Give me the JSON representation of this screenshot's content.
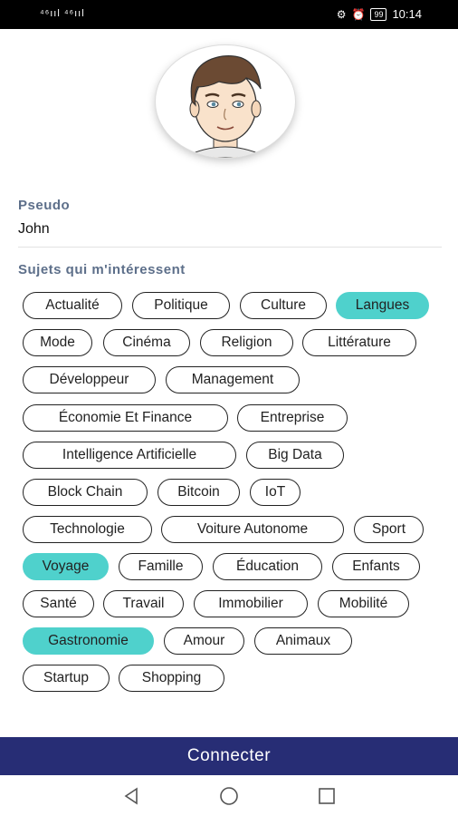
{
  "status_bar": {
    "signal": "⁴⁶ııl ⁴⁶ııl",
    "battery": "99",
    "time": "10:14"
  },
  "profile": {
    "pseudo_label": "Pseudo",
    "pseudo_value": "John",
    "subjects_label": "Sujets qui m'intéressent"
  },
  "tags": [
    {
      "label": "Actualité",
      "selected": false
    },
    {
      "label": "Politique",
      "selected": false
    },
    {
      "label": "Culture",
      "selected": false
    },
    {
      "label": "Langues",
      "selected": true
    },
    {
      "label": "Mode",
      "selected": false
    },
    {
      "label": "Cinéma",
      "selected": false
    },
    {
      "label": "Religion",
      "selected": false
    },
    {
      "label": "Littérature",
      "selected": false
    },
    {
      "label": "Développeur",
      "selected": false
    },
    {
      "label": "Management",
      "selected": false
    },
    {
      "label": "Économie Et Finance",
      "selected": false
    },
    {
      "label": "Entreprise",
      "selected": false
    },
    {
      "label": "Intelligence Artificielle",
      "selected": false
    },
    {
      "label": "Big Data",
      "selected": false
    },
    {
      "label": "Block Chain",
      "selected": false
    },
    {
      "label": "Bitcoin",
      "selected": false
    },
    {
      "label": "IoT",
      "selected": false
    },
    {
      "label": "Technologie",
      "selected": false
    },
    {
      "label": "Voiture Autonome",
      "selected": false
    },
    {
      "label": "Sport",
      "selected": false
    },
    {
      "label": "Voyage",
      "selected": true
    },
    {
      "label": "Famille",
      "selected": false
    },
    {
      "label": "Éducation",
      "selected": false
    },
    {
      "label": "Enfants",
      "selected": false
    },
    {
      "label": "Santé",
      "selected": false
    },
    {
      "label": "Travail",
      "selected": false
    },
    {
      "label": "Immobilier",
      "selected": false
    },
    {
      "label": "Mobilité",
      "selected": false
    },
    {
      "label": "Gastronomie",
      "selected": true
    },
    {
      "label": "Amour",
      "selected": false
    },
    {
      "label": "Animaux",
      "selected": false
    },
    {
      "label": "Startup",
      "selected": false
    },
    {
      "label": "Shopping",
      "selected": false
    }
  ],
  "connect_label": "Connecter",
  "colors": {
    "accent": "#4fd1cc",
    "primary": "#272d75",
    "label": "#5d6f8a"
  },
  "nav": {
    "back": "back-icon",
    "home": "home-icon",
    "recents": "recents-icon"
  }
}
